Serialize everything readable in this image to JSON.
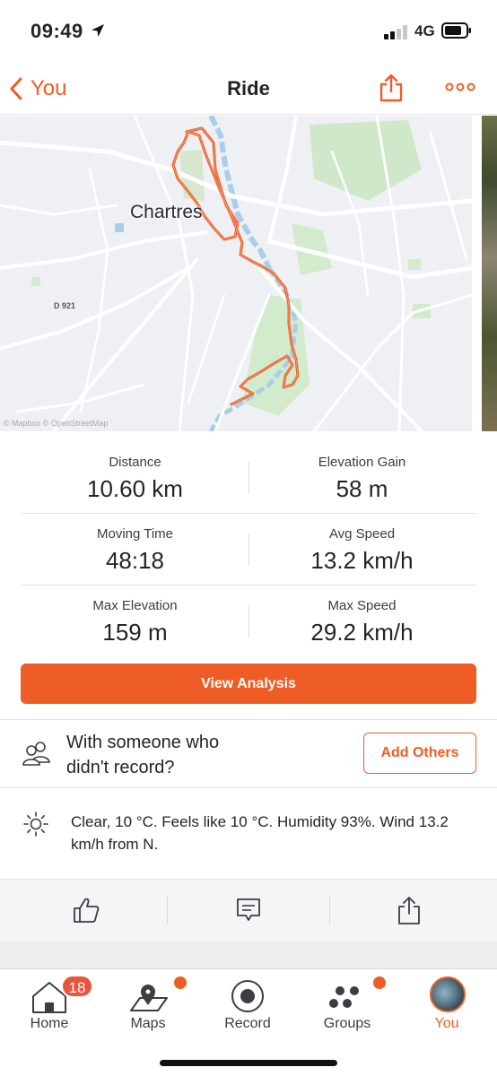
{
  "status_bar": {
    "time": "09:49",
    "network": "4G"
  },
  "nav": {
    "back_label": "You",
    "title": "Ride"
  },
  "map": {
    "place_label": "Chartres",
    "road_label": "D 921",
    "credit": "© Mapbox  © OpenStreetMap",
    "route_color": "#ee5d26"
  },
  "stats": [
    {
      "label": "Distance",
      "value": "10.60 km"
    },
    {
      "label": "Elevation Gain",
      "value": "58 m"
    },
    {
      "label": "Moving Time",
      "value": "48:18"
    },
    {
      "label": "Avg Speed",
      "value": "13.2 km/h"
    },
    {
      "label": "Max Elevation",
      "value": "159 m"
    },
    {
      "label": "Max Speed",
      "value": "29.2 km/h"
    }
  ],
  "analysis_button": "View Analysis",
  "with_others": {
    "text": "With someone who didn't record?",
    "button": "Add Others"
  },
  "weather": "Clear, 10 °C. Feels like 10 °C. Humidity 93%. Wind 13.2 km/h from N.",
  "actions": [
    "thumbs-up-icon",
    "comment-icon",
    "share-icon"
  ],
  "tabs": [
    {
      "label": "Home",
      "badge": "18"
    },
    {
      "label": "Maps"
    },
    {
      "label": "Record"
    },
    {
      "label": "Groups"
    },
    {
      "label": "You"
    }
  ],
  "colors": {
    "accent": "#ee5d26",
    "badge": "#e8543d"
  }
}
